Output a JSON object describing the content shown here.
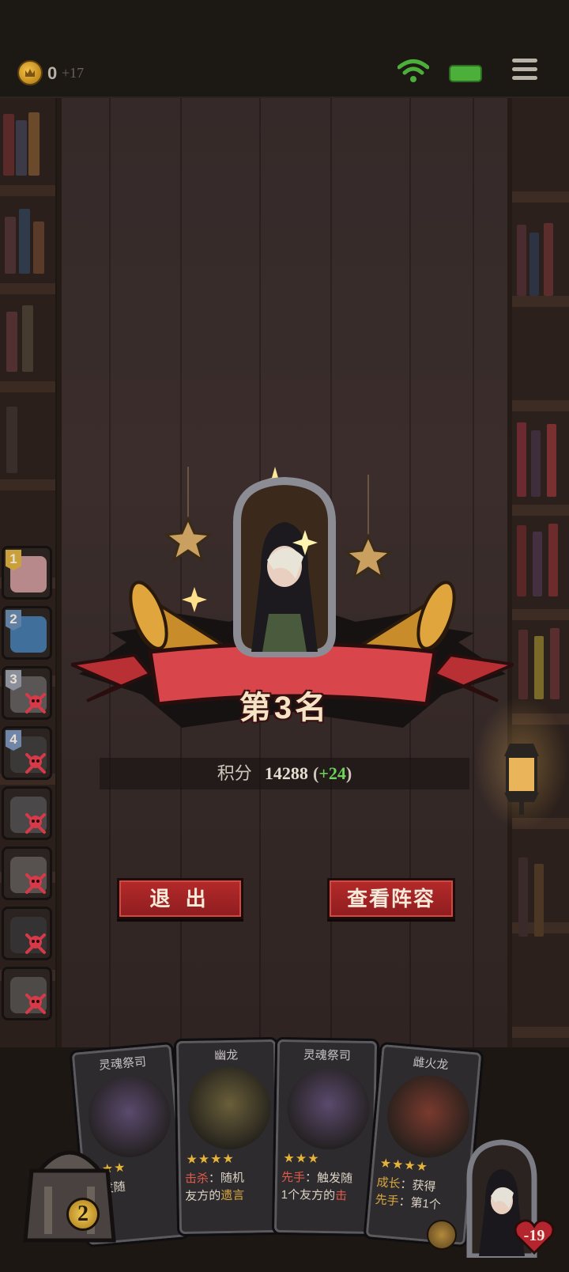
{
  "status_bar": {
    "coins": "0",
    "coin_gain": "+17",
    "icons": [
      "coin-icon",
      "wifi-icon",
      "battery-icon",
      "menu-icon"
    ],
    "battery_color": "#4caf3a"
  },
  "ranking": {
    "items": [
      {
        "rank": "1",
        "eliminated": false,
        "badge_color": "#caa03a",
        "face_color": "#b8898a"
      },
      {
        "rank": "2",
        "eliminated": false,
        "badge_color": "#5f7fa3",
        "face_color": "#3f6f9a"
      },
      {
        "rank": "3",
        "eliminated": true,
        "badge_color": "#8a8f99",
        "face_color": "#5a5656"
      },
      {
        "rank": "4",
        "eliminated": true,
        "badge_color": "#6f86a8",
        "face_color": "#3b3838"
      },
      {
        "rank": "",
        "eliminated": true,
        "face_color": "#4a4848"
      },
      {
        "rank": "",
        "eliminated": true,
        "face_color": "#575250"
      },
      {
        "rank": "",
        "eliminated": true,
        "face_color": "#343232"
      },
      {
        "rank": "",
        "eliminated": true,
        "face_color": "#4e4a48"
      }
    ]
  },
  "result": {
    "placement": "第3名"
  },
  "score": {
    "label": "积分",
    "value": "14288",
    "open": "(",
    "delta": "+24",
    "close": ")",
    "delta_color": "#6fd15a"
  },
  "buttons": {
    "exit": "退 出",
    "view_lineup": "查看阵容"
  },
  "hand": [
    {
      "name": "灵魂祭司",
      "stars": "★★★",
      "text_parts": [
        "",
        "触发随",
        "",
        ""
      ],
      "art_color": "#5b4a6e"
    },
    {
      "name": "幽龙",
      "stars": "★★★★",
      "text_parts": [
        "击杀",
        "：随机",
        "友方的",
        "遗言"
      ],
      "art_color": "#6a5f3a"
    },
    {
      "name": "灵魂祭司",
      "stars": "★★★",
      "text_parts": [
        "先手",
        "：触发随",
        "1个友方的",
        "击"
      ],
      "art_color": "#5b4a6e"
    },
    {
      "name": "雌火龙",
      "stars": "★★★★",
      "text_parts": [
        "成长",
        "：获得",
        "先手",
        "：第1个"
      ],
      "art_color": "#7a3a2e"
    }
  ],
  "hud": {
    "chest_count": "2",
    "health": "-19",
    "health_color": "#b5252e"
  }
}
